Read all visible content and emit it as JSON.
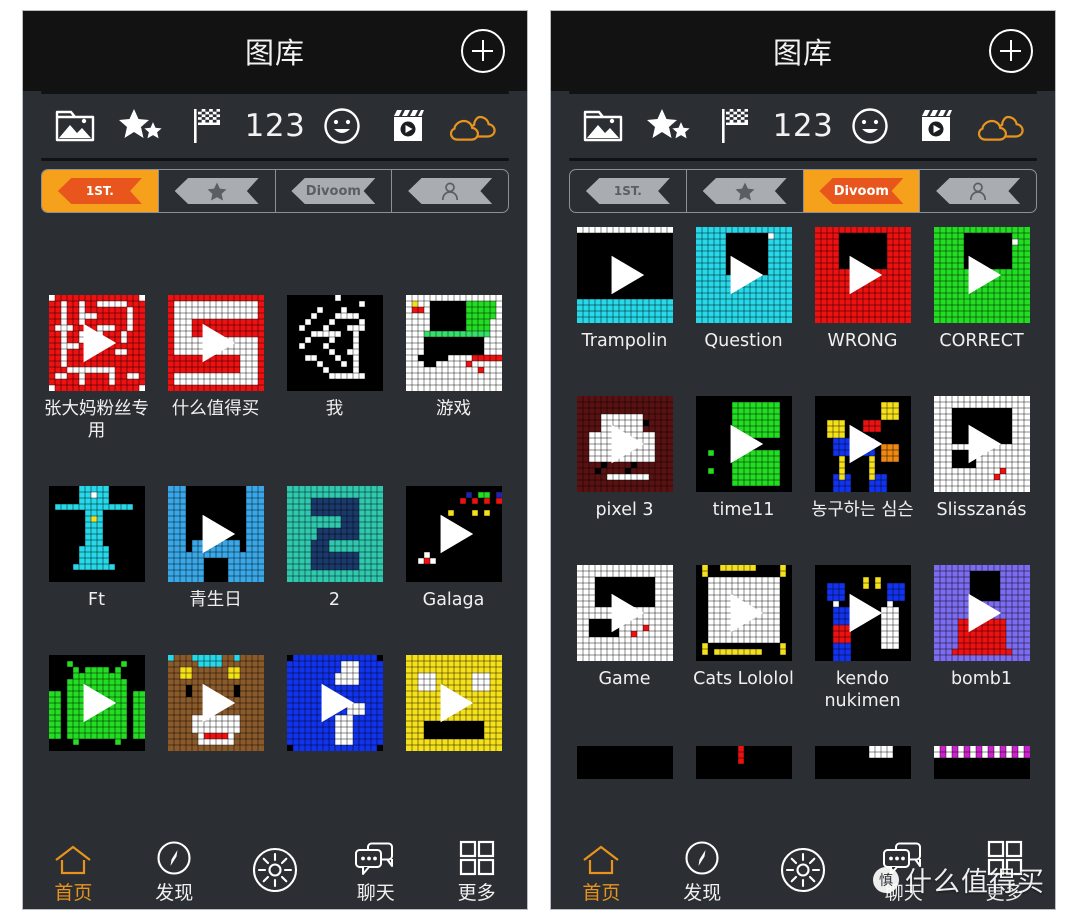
{
  "colors": {
    "accent_orange": "#f5a11b",
    "ribbon_red": "#e8551d",
    "panel_bg": "#2b2e33",
    "titlebar_bg": "#121212",
    "text": "#f0f0f0",
    "nav_active": "#e8941c"
  },
  "panels": [
    {
      "id": "left",
      "header": {
        "title": "图库",
        "add_button_label": "+",
        "add_icon": "plus-circle-icon"
      },
      "category_icons": [
        {
          "name": "photo-folder-icon",
          "label": ""
        },
        {
          "name": "stars-icon",
          "label": ""
        },
        {
          "name": "checkered-flag-icon",
          "label": ""
        },
        {
          "name": "numbers-icon",
          "label": "123"
        },
        {
          "name": "smiley-face-icon",
          "label": ""
        },
        {
          "name": "clapperboard-play-icon",
          "label": ""
        },
        {
          "name": "clouds-icon",
          "label": ""
        }
      ],
      "tabs": [
        {
          "id": "rank",
          "label": "1ST.",
          "icon": "rank-ribbon-icon",
          "active": true
        },
        {
          "id": "star",
          "label": "",
          "icon": "star-ribbon-icon",
          "active": false
        },
        {
          "id": "divoom",
          "label": "Divoom",
          "icon": "divoom-ribbon-icon",
          "active": false
        },
        {
          "id": "user",
          "label": "",
          "icon": "user-ribbon-icon",
          "active": false
        }
      ],
      "cut_off_row_hint": "partially scrolled-off captions",
      "grid_rows": [
        [
          {
            "name": "张大妈粉丝专用"
          },
          {
            "name": "什么值得买"
          },
          {
            "name": "我"
          },
          {
            "name": "游戏"
          }
        ],
        [
          {
            "name": "Ft"
          },
          {
            "name": "青生日"
          },
          {
            "name": "2"
          },
          {
            "name": "Galaga"
          }
        ],
        [
          {
            "name": ""
          },
          {
            "name": ""
          },
          {
            "name": ""
          },
          {
            "name": ""
          }
        ]
      ],
      "bottom_nav": [
        {
          "id": "home",
          "label": "首页",
          "icon": "home-icon",
          "active": true
        },
        {
          "id": "discover",
          "label": "发现",
          "icon": "compass-icon",
          "active": false
        },
        {
          "id": "center",
          "label": "",
          "icon": "brightness-sun-icon",
          "active": false
        },
        {
          "id": "chat",
          "label": "聊天",
          "icon": "chat-bubbles-icon",
          "active": false
        },
        {
          "id": "more",
          "label": "更多",
          "icon": "grid-squares-icon",
          "active": false
        }
      ]
    },
    {
      "id": "right",
      "header": {
        "title": "图库",
        "add_button_label": "+",
        "add_icon": "plus-circle-icon"
      },
      "category_icons": [
        {
          "name": "photo-folder-icon",
          "label": ""
        },
        {
          "name": "stars-icon",
          "label": ""
        },
        {
          "name": "checkered-flag-icon",
          "label": ""
        },
        {
          "name": "numbers-icon",
          "label": "123"
        },
        {
          "name": "smiley-face-icon",
          "label": ""
        },
        {
          "name": "clapperboard-play-icon",
          "label": ""
        },
        {
          "name": "clouds-icon",
          "label": ""
        }
      ],
      "tabs": [
        {
          "id": "rank",
          "label": "1ST.",
          "icon": "rank-ribbon-icon",
          "active": false
        },
        {
          "id": "star",
          "label": "",
          "icon": "star-ribbon-icon",
          "active": false
        },
        {
          "id": "divoom",
          "label": "Divoom",
          "icon": "divoom-ribbon-icon",
          "active": true
        },
        {
          "id": "user",
          "label": "",
          "icon": "user-ribbon-icon",
          "active": false
        }
      ],
      "grid_rows": [
        [
          {
            "name": "Trampolin"
          },
          {
            "name": "Question"
          },
          {
            "name": "WRONG"
          },
          {
            "name": "CORRECT"
          }
        ],
        [
          {
            "name": "pixel 3"
          },
          {
            "name": "time11"
          },
          {
            "name": "농구하는 심슨"
          },
          {
            "name": "Slisszanás"
          }
        ],
        [
          {
            "name": "Game"
          },
          {
            "name": "Cats Lololol"
          },
          {
            "name": "kendo nukimen"
          },
          {
            "name": "bomb1"
          }
        ],
        [
          {
            "name": ""
          },
          {
            "name": ""
          },
          {
            "name": ""
          },
          {
            "name": ""
          }
        ]
      ],
      "bottom_nav": [
        {
          "id": "home",
          "label": "首页",
          "icon": "home-icon",
          "active": true
        },
        {
          "id": "discover",
          "label": "发现",
          "icon": "compass-icon",
          "active": false
        },
        {
          "id": "center",
          "label": "",
          "icon": "brightness-sun-icon",
          "active": false
        },
        {
          "id": "chat",
          "label": "聊天",
          "icon": "chat-bubbles-icon",
          "active": false
        },
        {
          "id": "more",
          "label": "更多",
          "icon": "grid-squares-icon",
          "active": false
        }
      ],
      "watermark": {
        "logo": "慎",
        "text": "什么值得买"
      }
    }
  ]
}
